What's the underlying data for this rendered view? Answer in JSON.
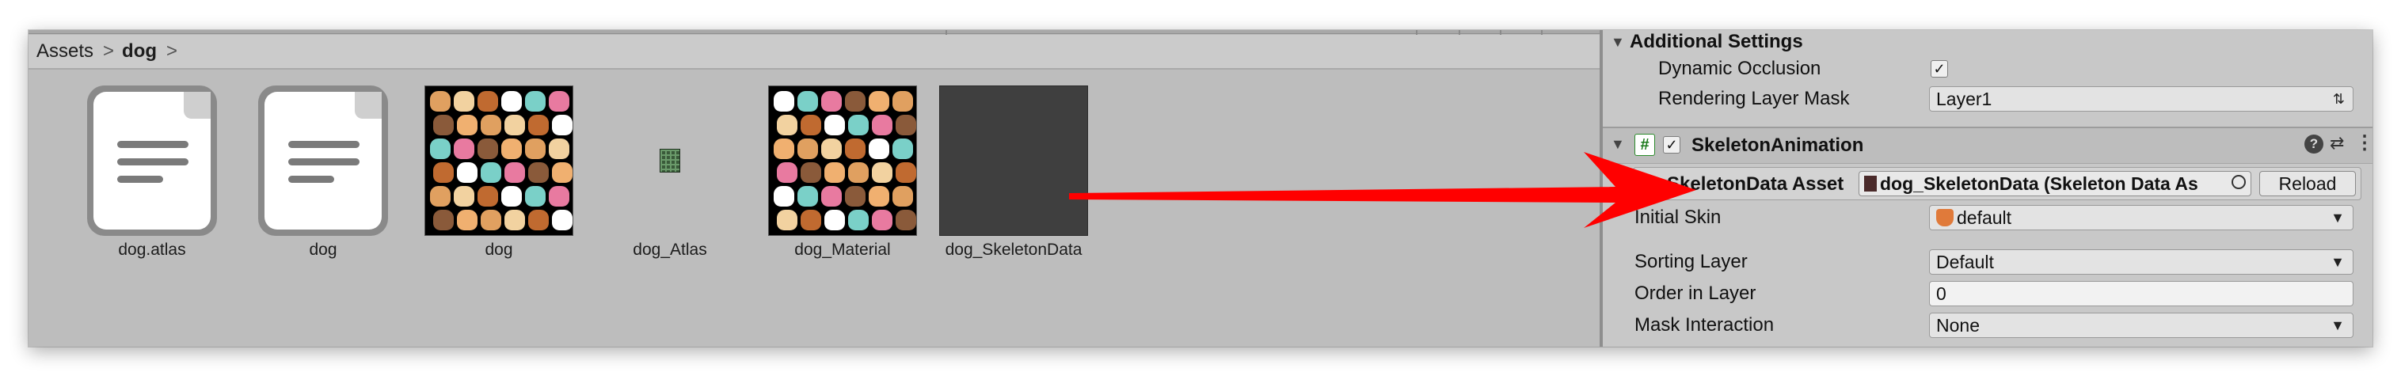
{
  "breadcrumb": {
    "root": "Assets",
    "current": "dog",
    "separator": ">"
  },
  "assets": [
    {
      "name": "dog.atlas",
      "icon": "text-file-icon"
    },
    {
      "name": "dog",
      "icon": "text-file-icon"
    },
    {
      "name": "dog",
      "icon": "texture-thumbnail"
    },
    {
      "name": "dog_Atlas",
      "icon": "atlas-asset-icon"
    },
    {
      "name": "dog_Material",
      "icon": "material-thumbnail"
    },
    {
      "name": "dog_SkeletonData",
      "icon": "skeleton-data-thumbnail"
    }
  ],
  "inspector": {
    "additional_settings": {
      "title": "Additional Settings",
      "dynamic_occlusion_label": "Dynamic Occlusion",
      "dynamic_occlusion_checked": "✓",
      "rendering_layer_mask_label": "Rendering Layer Mask",
      "rendering_layer_mask_value": "Layer1"
    },
    "skeleton_animation": {
      "title": "SkeletonAnimation",
      "enabled_check": "✓",
      "script_badge": "#",
      "skeleton_data_label": "SkeletonData Asset",
      "skeleton_data_value": "dog_SkeletonData (Skeleton Data As",
      "reload_label": "Reload",
      "initial_skin_label": "Initial Skin",
      "initial_skin_value": "default",
      "sorting_layer_label": "Sorting Layer",
      "sorting_layer_value": "Default",
      "order_in_layer_label": "Order in Layer",
      "order_in_layer_value": "0",
      "mask_interaction_label": "Mask Interaction",
      "mask_interaction_value": "None"
    },
    "header_icons": [
      "help-icon",
      "presets-icon",
      "kebab-menu-icon"
    ]
  },
  "colors": {
    "arrow": "#ff0000",
    "panel_bg": "#bdbdbd",
    "inspector_bg": "#c8c8c8"
  }
}
